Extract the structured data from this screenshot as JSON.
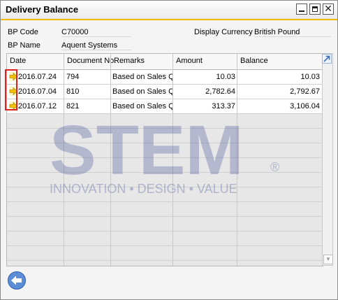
{
  "window": {
    "title": "Delivery Balance"
  },
  "header": {
    "bp_code_label": "BP Code",
    "bp_code_value": "C70000",
    "bp_name_label": "BP Name",
    "bp_name_value": "Aquent Systems",
    "display_currency_label": "Display Currency",
    "display_currency_value": "British Pound"
  },
  "table": {
    "columns": [
      "Date",
      "Document No.",
      "Remarks",
      "Amount",
      "Balance"
    ],
    "rows": [
      {
        "date": "2016.07.24",
        "doc": "794",
        "remarks": "Based on Sales Quot",
        "amount": "10.03",
        "balance": "10.03"
      },
      {
        "date": "2016.07.04",
        "doc": "810",
        "remarks": "Based on Sales Quot",
        "amount": "2,782.64",
        "balance": "2,792.67"
      },
      {
        "date": "2016.07.12",
        "doc": "821",
        "remarks": "Based on Sales Quot",
        "amount": "313.37",
        "balance": "3,106.04"
      }
    ]
  },
  "watermark": {
    "logo_text": "STEM",
    "registered": "®",
    "tagline": "INNOVATION • DESIGN • VALUE"
  },
  "icons": {
    "link_arrow": "link-arrow-icon",
    "expand": "expand-icon",
    "back": "back-arrow-icon"
  },
  "colors": {
    "title_underline": "#f0b800",
    "highlight_box": "#e02020",
    "watermark": "#2f3f8f"
  }
}
